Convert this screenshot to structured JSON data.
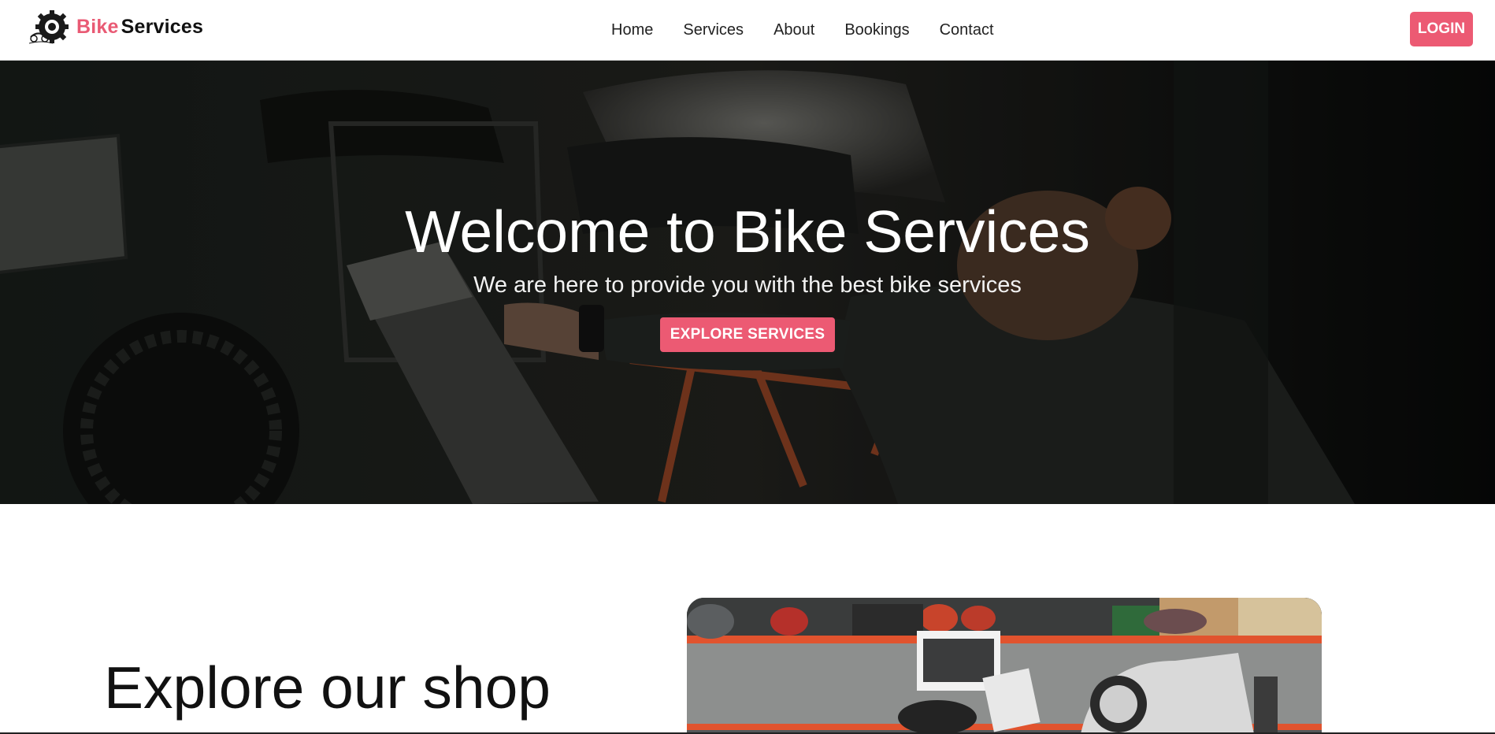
{
  "brand": {
    "logo_icon": "motorcycle-gear-logo-icon",
    "accent_text": "Bike",
    "rest_text": "Services",
    "accent_color": "#e95a74"
  },
  "nav": {
    "items": [
      {
        "label": "Home"
      },
      {
        "label": "Services"
      },
      {
        "label": "About"
      },
      {
        "label": "Bookings"
      },
      {
        "label": "Contact"
      }
    ],
    "login_label": "LOGIN"
  },
  "hero": {
    "title": "Welcome to Bike Services",
    "subtitle": "We are here to provide you with the best bike services",
    "cta_label": "EXPLORE SERVICES",
    "image": "mechanic-working-on-motorcycle-photo"
  },
  "shop": {
    "title": "Explore our shop",
    "image": "motorcycle-workshop-photo"
  },
  "colors": {
    "accent": "#ec5a73",
    "text": "#111111",
    "hero_overlay": "#0f1311"
  }
}
